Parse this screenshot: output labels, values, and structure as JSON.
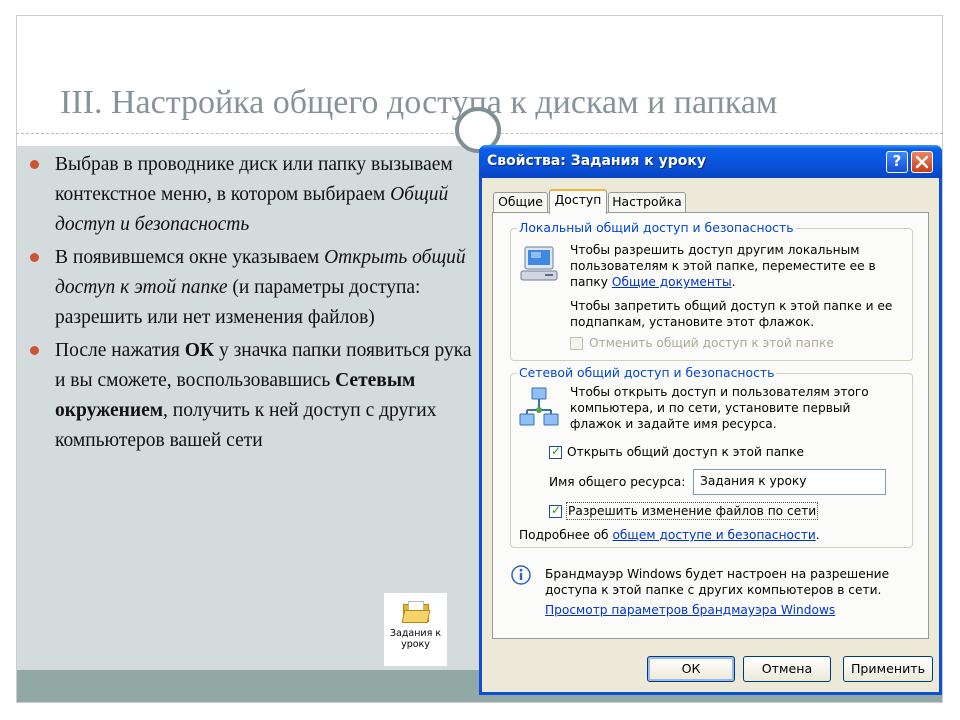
{
  "slide": {
    "title": "III. Настройка общего доступа к дискам и папкам",
    "bullets": [
      {
        "parts": [
          {
            "t": "Выбрав в проводнике диск или папку вызываем контекстное меню, в котором выбираем ",
            "s": "n"
          },
          {
            "t": "Общий доступ и безопасность",
            "s": "i"
          }
        ]
      },
      {
        "parts": [
          {
            "t": "В появившемся окне  указываем ",
            "s": "n"
          },
          {
            "t": "Открыть общий доступ к этой папке",
            "s": "i"
          },
          {
            "t": " (и параметры доступа: разрешить или нет изменения файлов)",
            "s": "n"
          }
        ]
      },
      {
        "parts": [
          {
            "t": " После нажатия ",
            "s": "n"
          },
          {
            "t": "ОК",
            "s": "b"
          },
          {
            "t": " у значка папки появиться рука и вы сможете, воспользовавшись ",
            "s": "n"
          },
          {
            "t": "Сетевым окружением",
            "s": "b"
          },
          {
            "t": ", получить к ней доступ с других компьютеров вашей сети",
            "s": "n"
          }
        ]
      }
    ],
    "folder_tile": {
      "icon": "folder-icon",
      "label_line1": "Задания к",
      "label_line2": "уроку"
    },
    "colors": {
      "title": "#85939a",
      "bullet": "#d0532f",
      "content_bg": "#d3dbdd",
      "footer_bar": "#91a8a5"
    }
  },
  "dialog": {
    "title": "Свойства: Задания к уроку",
    "help_button": "?",
    "close_button": "X",
    "tabs": [
      "Общие",
      "Доступ",
      "Настройка"
    ],
    "active_tab": "Доступ",
    "local_group": {
      "legend": "Локальный общий доступ и безопасность",
      "icon": "computer-icon",
      "text1_line1": "Чтобы разрешить доступ другим локальным",
      "text1_line2": "пользователям к этой папке, переместите ее в",
      "text1_line3_prefix": "папку ",
      "shared_docs_link": "Общие документы",
      "text1_line3_suffix": ".",
      "text2_line1": "Чтобы запретить общий доступ к этой папке и ее",
      "text2_line2": "подпапкам, установите этот флажок.",
      "disable_sharing_checkbox": {
        "label": "Отменить общий доступ к этой папке",
        "checked": false,
        "enabled": false
      }
    },
    "network_group": {
      "legend": "Сетевой общий доступ и безопасность",
      "icon": "network-icon",
      "text_line1": "Чтобы открыть доступ и пользователям этого",
      "text_line2": "компьютера, и по сети, установите первый",
      "text_line3": "флажок и задайте имя ресурса.",
      "share_checkbox": {
        "label": "Открыть общий доступ к этой папке",
        "checked": true
      },
      "share_name_label": "Имя общего ресурса:",
      "share_name_value": "Задания к уроку",
      "allow_changes_checkbox": {
        "label": "Разрешить изменение файлов по сети",
        "checked": true
      },
      "more_info_prefix": "Подробнее об ",
      "more_info_link": "общем доступе и безопасности",
      "more_info_suffix": "."
    },
    "firewall": {
      "icon": "info-icon",
      "text_line1": "Брандмауэр Windows будет настроен на разрешение",
      "text_line2": "доступа к этой папке с других компьютеров в сети.",
      "settings_link": "Просмотр параметров брандмауэра Windows"
    },
    "buttons": {
      "ok": "ОК",
      "cancel": "Отмена",
      "apply": "Применить"
    },
    "colors": {
      "titlebar": "#0a52da",
      "legend": "#0046d5",
      "link": "#0033cc",
      "face": "#ece9d8"
    }
  }
}
